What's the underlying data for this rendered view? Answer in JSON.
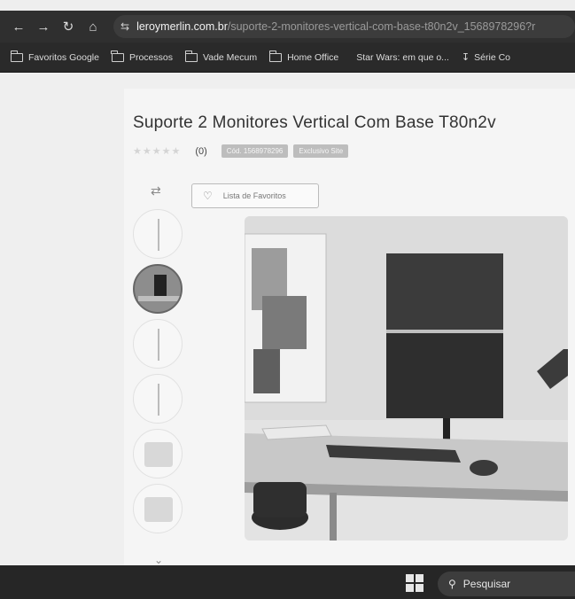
{
  "browser": {
    "url_host": "leroymerlin.com.br",
    "url_path": "/suporte-2-monitores-vertical-com-base-t80n2v_1568978296?r"
  },
  "bookmarks": [
    {
      "label": "Favoritos Google"
    },
    {
      "label": "Processos"
    },
    {
      "label": "Vade Mecum"
    },
    {
      "label": "Home Office"
    },
    {
      "label": "Star Wars: em que o..."
    },
    {
      "label": "Série Co"
    }
  ],
  "product": {
    "title": "Suporte 2 Monitores Vertical Com Base T80n2v",
    "rating_count": "(0)",
    "badge_code": "Cód. 1568978296",
    "badge_exclusive": "Exclusivo Site",
    "favorite_label": "Lista de Favoritos"
  },
  "taskbar": {
    "search_placeholder": "Pesquisar"
  }
}
